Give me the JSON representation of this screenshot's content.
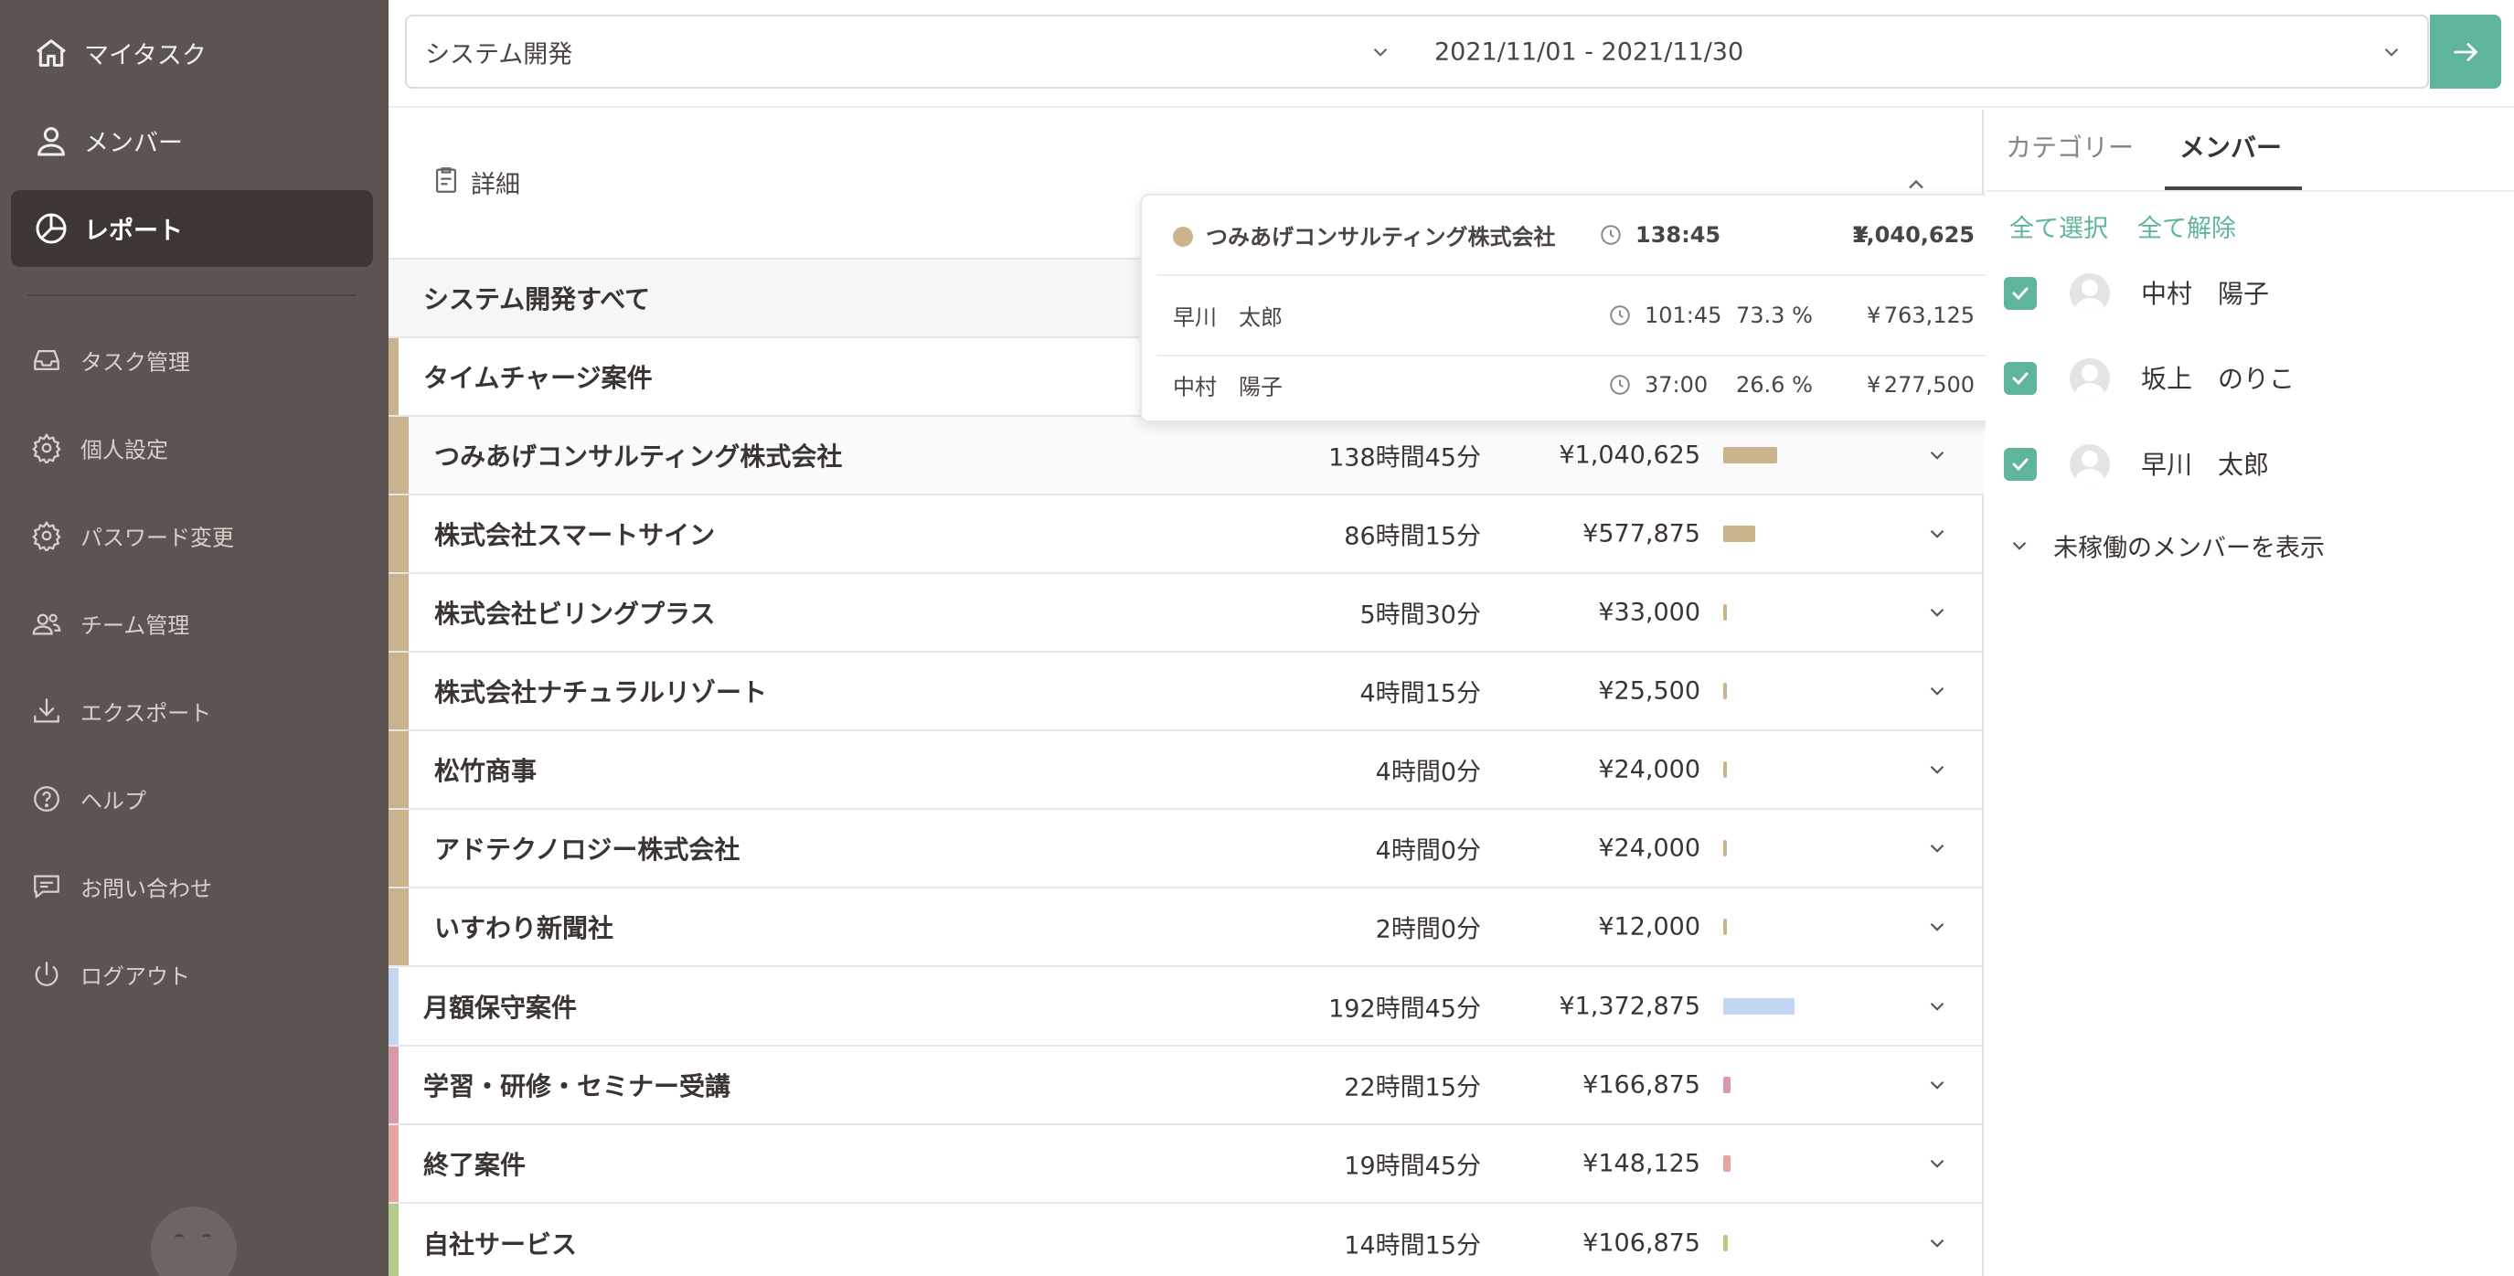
{
  "sidebar": {
    "primary": [
      {
        "label": "マイタスク",
        "icon": "home-icon"
      },
      {
        "label": "メンバー",
        "icon": "user-icon"
      },
      {
        "label": "レポート",
        "icon": "pie-chart-icon",
        "active": true
      }
    ],
    "secondary": [
      {
        "label": "タスク管理",
        "icon": "inbox-icon"
      },
      {
        "label": "個人設定",
        "icon": "gear-icon"
      },
      {
        "label": "パスワード変更",
        "icon": "gear-icon"
      },
      {
        "label": "チーム管理",
        "icon": "team-icon"
      },
      {
        "label": "エクスポート",
        "icon": "download-icon"
      },
      {
        "label": "ヘルプ",
        "icon": "help-icon"
      },
      {
        "label": "お問い合わせ",
        "icon": "message-icon"
      },
      {
        "label": "ログアウト",
        "icon": "power-icon"
      }
    ]
  },
  "filters": {
    "project": "システム開発",
    "date_range": "2021/11/01 - 2021/11/30"
  },
  "detail": {
    "header": "詳細",
    "all_row": "システム開発すべて"
  },
  "groups": [
    {
      "name": "タイムチャージ案件",
      "color": "#c9b48d",
      "clients": [
        {
          "name": "つみあげコンサルティング株式会社",
          "hours": "138時間45分",
          "amount": "¥1,040,625",
          "share": 0.22
        },
        {
          "name": "株式会社スマートサイン",
          "hours": "86時間15分",
          "amount": "¥577,875",
          "share": 0.13
        },
        {
          "name": "株式会社ビリングプラス",
          "hours": "5時間30分",
          "amount": "¥33,000",
          "share": 0.01
        },
        {
          "name": "株式会社ナチュラルリゾート",
          "hours": "4時間15分",
          "amount": "¥25,500",
          "share": 0.01
        },
        {
          "name": "松竹商事",
          "hours": "4時間0分",
          "amount": "¥24,000",
          "share": 0.01
        },
        {
          "name": "アドテクノロジー株式会社",
          "hours": "4時間0分",
          "amount": "¥24,000",
          "share": 0.01
        },
        {
          "name": "いすわり新聞社",
          "hours": "2時間0分",
          "amount": "¥12,000",
          "share": 0.01
        }
      ]
    },
    {
      "name": "月額保守案件",
      "hours": "192時間45分",
      "amount": "¥1,372,875",
      "color": "#c3d6f2",
      "share": 0.29
    },
    {
      "name": "学習・研修・セミナー受講",
      "hours": "22時間15分",
      "amount": "¥166,875",
      "color": "#d89aa7",
      "share": 0.03
    },
    {
      "name": "終了案件",
      "hours": "19時間45分",
      "amount": "¥148,125",
      "color": "#e8a4a0",
      "share": 0.03
    },
    {
      "name": "自社サービス",
      "hours": "14時間15分",
      "amount": "¥106,875",
      "color": "#b4c98a",
      "share": 0.02
    }
  ],
  "tooltip": {
    "client": "つみあげコンサルティング株式会社",
    "total_time": "138:45",
    "yen": "¥",
    "total_amount": "1,040,625",
    "dot_color": "#c9b48d",
    "members": [
      {
        "name": "早川　太郎",
        "time": "101:45",
        "pct": "73.3 %",
        "amount": "763,125"
      },
      {
        "name": "中村　陽子",
        "time": "37:00",
        "pct": "26.6 %",
        "amount": "277,500"
      }
    ]
  },
  "right_panel": {
    "tabs": [
      "カテゴリー",
      "メンバー"
    ],
    "active_tab": "メンバー",
    "select_all": "全て選択",
    "deselect_all": "全て解除",
    "members": [
      {
        "name": "中村　陽子",
        "checked": true
      },
      {
        "name": "坂上　のりこ",
        "checked": true
      },
      {
        "name": "早川　太郎",
        "checked": true
      }
    ],
    "show_inactive": "未稼働のメンバーを表示"
  },
  "colors": {
    "accent": "#5fb49c",
    "sidebar_bg": "#5c5450",
    "sidebar_active": "#3d3633"
  }
}
